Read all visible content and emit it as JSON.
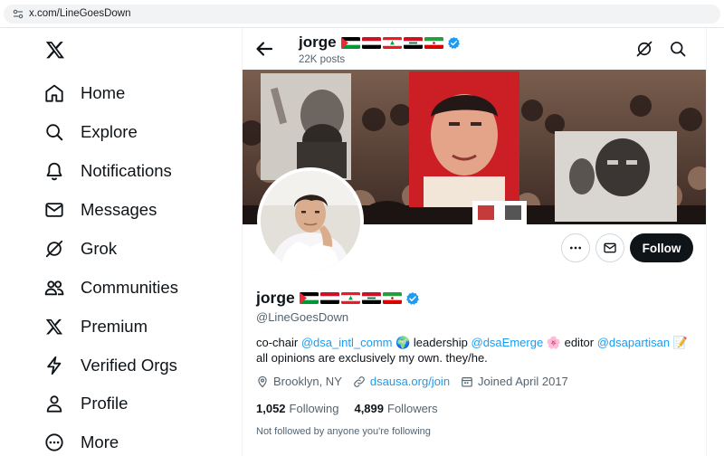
{
  "browser": {
    "url": "x.com/LineGoesDown"
  },
  "nav": {
    "items": [
      {
        "label": "Home",
        "icon": "home-icon"
      },
      {
        "label": "Explore",
        "icon": "search-icon"
      },
      {
        "label": "Notifications",
        "icon": "bell-icon"
      },
      {
        "label": "Messages",
        "icon": "envelope-icon"
      },
      {
        "label": "Grok",
        "icon": "grok-icon"
      },
      {
        "label": "Communities",
        "icon": "people-icon"
      },
      {
        "label": "Premium",
        "icon": "x-logo-icon"
      },
      {
        "label": "Verified Orgs",
        "icon": "lightning-icon"
      },
      {
        "label": "Profile",
        "icon": "person-icon"
      },
      {
        "label": "More",
        "icon": "more-circle-icon"
      }
    ]
  },
  "header": {
    "name": "jorge",
    "posts": "22K posts"
  },
  "profile": {
    "name": "jorge",
    "handle": "@LineGoesDown",
    "bio": {
      "t1": "co-chair ",
      "l1": "@dsa_intl_comm",
      "t2": " 🌍 leadership ",
      "l2": "@dsaEmerge",
      "t3": " 🌸 editor ",
      "l3": "@dsapartisan",
      "t4": " 📝",
      "line2": "all opinions are exclusively my own. they/he."
    },
    "location": "Brooklyn, NY",
    "website": "dsausa.org/join",
    "joined": "Joined April 2017",
    "following_count": "1,052",
    "following_label": "Following",
    "followers_count": "4,899",
    "followers_label": "Followers",
    "not_followed": "Not followed by anyone you're following"
  },
  "actions": {
    "follow": "Follow"
  },
  "flags": [
    "palestine-flag",
    "yemen-flag",
    "lebanon-flag",
    "iraq-flag",
    "iran-flag"
  ],
  "colors": {
    "accent": "#1d9bf0",
    "text": "#0f1419",
    "muted": "#536471",
    "button": "#0f1419"
  }
}
